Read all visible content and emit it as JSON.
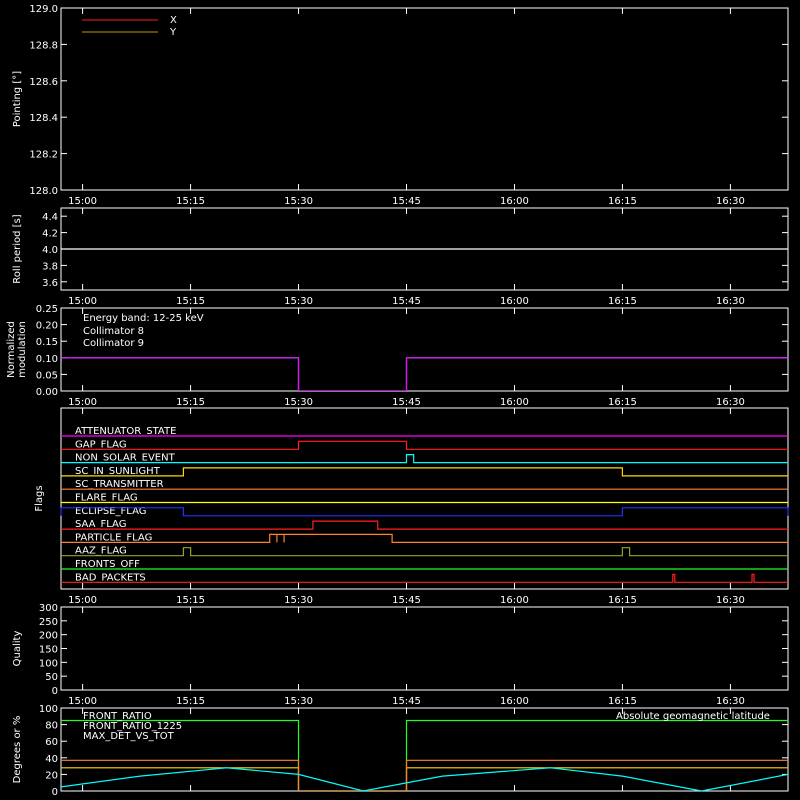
{
  "chart_data": [
    {
      "type": "line",
      "ylabel": "Pointing [°]",
      "ylim": [
        128.0,
        129.0
      ],
      "yticks": [
        "128.0",
        "128.2",
        "128.4",
        "128.6",
        "128.8",
        "129.0"
      ],
      "legend": [
        "X",
        "Y"
      ],
      "legend_colors": [
        "#ff2020",
        "#b8a000"
      ],
      "series": [
        {
          "name": "X",
          "color": "#ff2020",
          "x": [],
          "y": []
        },
        {
          "name": "Y",
          "color": "#b8a000",
          "x": [],
          "y": []
        }
      ]
    },
    {
      "type": "line",
      "ylabel": "Roll period [s]",
      "ylim": [
        3.5,
        4.5
      ],
      "yticks": [
        "3.6",
        "3.8",
        "4.0",
        "4.2",
        "4.4"
      ],
      "series": [
        {
          "color": "#ffffff",
          "x": [
            "14:57",
            "16:38"
          ],
          "y": [
            4.0,
            4.0
          ]
        }
      ]
    },
    {
      "type": "line",
      "ylabel": "Normalized modulation",
      "ylim": [
        0.0,
        0.25
      ],
      "yticks": [
        "0.00",
        "0.05",
        "0.10",
        "0.15",
        "0.20",
        "0.25"
      ],
      "annotation": "Energy band: 12-25 keV",
      "legend": [
        "Collimator 8",
        "Collimator 9"
      ],
      "legend_colors": [
        "#00ffff",
        "#ff00ff"
      ],
      "series": [
        {
          "name": "Collimator 8",
          "color": "#00ffff",
          "x": [
            "14:57",
            "15:30",
            "15:30",
            "15:45",
            "15:45",
            "16:38"
          ],
          "y": [
            0.1,
            0.1,
            0.0,
            0.0,
            0.1,
            0.1
          ]
        },
        {
          "name": "Collimator 9",
          "color": "#ff00ff",
          "x": [
            "14:57",
            "15:30",
            "15:30",
            "15:45",
            "15:45",
            "16:38"
          ],
          "y": [
            0.1,
            0.1,
            0.0,
            0.0,
            0.1,
            0.1
          ]
        }
      ]
    },
    {
      "type": "line",
      "ylabel": "Flags",
      "flags": [
        {
          "name": "ATTENUATOR_STATE",
          "color": "#ff00ff",
          "on": []
        },
        {
          "name": "GAP_FLAG",
          "color": "#ff2020",
          "on": [
            [
              "15:30",
              "15:45"
            ]
          ]
        },
        {
          "name": "NON_SOLAR_EVENT",
          "color": "#00ffff",
          "on": [
            [
              "15:45",
              "15:46"
            ]
          ]
        },
        {
          "name": "SC_IN_SUNLIGHT",
          "color": "#ffd700",
          "on": [
            [
              "15:14",
              "16:15"
            ]
          ]
        },
        {
          "name": "SC_TRANSMITTER",
          "color": "#ff8030",
          "on": []
        },
        {
          "name": "FLARE_FLAG",
          "color": "#ffff00",
          "on": []
        },
        {
          "name": "ECLIPSE_FLAG",
          "color": "#2030ff",
          "on": [
            [
              "14:57",
              "15:14"
            ],
            [
              "16:15",
              "16:38"
            ]
          ]
        },
        {
          "name": "SAA_FLAG",
          "color": "#ff2020",
          "on": [
            [
              "15:32",
              "15:41"
            ]
          ]
        },
        {
          "name": "PARTICLE_FLAG",
          "color": "#ff8030",
          "on": [
            [
              "15:26",
              "15:27"
            ],
            [
              "15:27",
              "15:28"
            ],
            [
              "15:28",
              "15:43"
            ]
          ]
        },
        {
          "name": "AAZ_FLAG",
          "color": "#9aa030",
          "on": [
            [
              "15:14",
              "15:15"
            ],
            [
              "16:15",
              "16:16"
            ]
          ]
        },
        {
          "name": "FRONTS_OFF",
          "color": "#20ff20",
          "on": []
        },
        {
          "name": "BAD_PACKETS",
          "color": "#ff2020",
          "on": [
            [
              "16:22",
              "16:22"
            ],
            [
              "16:33",
              "16:33"
            ]
          ]
        }
      ]
    },
    {
      "type": "line",
      "ylabel": "Quality",
      "ylim": [
        0,
        300
      ],
      "yticks": [
        "0",
        "50",
        "100",
        "150",
        "200",
        "250",
        "300"
      ],
      "series": []
    },
    {
      "type": "line",
      "ylabel": "Degrees or %",
      "ylim": [
        0,
        100
      ],
      "yticks": [
        "0",
        "20",
        "40",
        "60",
        "80",
        "100"
      ],
      "legend": [
        "FRONT_RATIO",
        "FRONT_RATIO_1225",
        "MAX_DET_VS_TOT"
      ],
      "legend_colors": [
        "#20ff20",
        "#ffd700",
        "#ff8030"
      ],
      "legend2": "Absolute geomagnetic latitude",
      "legend2_color": "#00ffff",
      "series": [
        {
          "name": "FRONT_RATIO",
          "color": "#20ff20",
          "x": [
            "14:57",
            "15:30",
            "15:30",
            "15:45",
            "15:45",
            "16:38"
          ],
          "y": [
            85,
            85,
            0,
            0,
            85,
            85
          ]
        },
        {
          "name": "FRONT_RATIO_1225",
          "color": "#ffd700",
          "x": [
            "14:57",
            "15:30",
            "15:30",
            "15:45",
            "15:45",
            "16:38"
          ],
          "y": [
            28,
            28,
            0,
            0,
            28,
            28
          ]
        },
        {
          "name": "MAX_DET_VS_TOT",
          "color": "#ff8030",
          "x": [
            "14:57",
            "15:30",
            "15:30",
            "15:45",
            "15:45",
            "16:38"
          ],
          "y": [
            37,
            37,
            0,
            0,
            37,
            37
          ]
        },
        {
          "name": "Absolute geomagnetic latitude",
          "color": "#00ffff",
          "x": [
            "14:57",
            "15:08",
            "15:20",
            "15:30",
            "15:39",
            "15:50",
            "16:05",
            "16:15",
            "16:26",
            "16:38"
          ],
          "y": [
            5,
            18,
            28,
            20,
            0,
            18,
            28,
            18,
            0,
            20
          ]
        }
      ]
    }
  ],
  "time_axis": {
    "xlim": [
      "14:57",
      "16:38"
    ],
    "ticks": [
      "15:00",
      "15:15",
      "15:30",
      "15:45",
      "16:00",
      "16:15",
      "16:30"
    ]
  }
}
